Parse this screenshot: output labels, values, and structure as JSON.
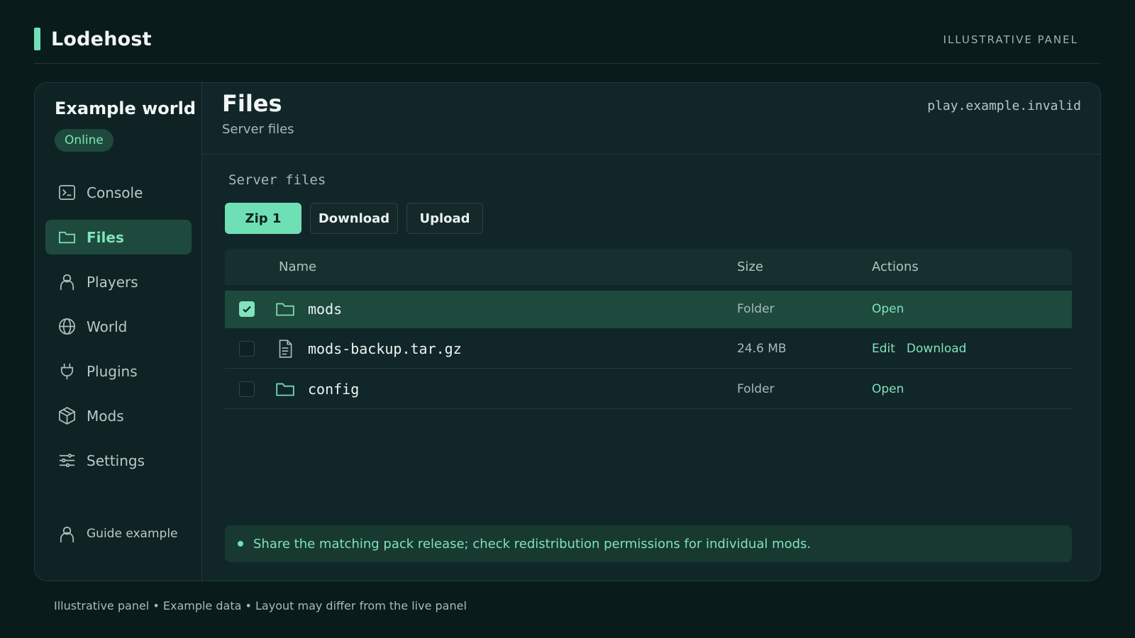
{
  "brand": {
    "name": "Lodehost",
    "tagline": "ILLUSTRATIVE PANEL"
  },
  "server": {
    "name": "Example world",
    "status": "Online",
    "host": "play.example.invalid"
  },
  "nav": {
    "items": [
      {
        "label": "Console",
        "icon": "terminal-icon",
        "active": false
      },
      {
        "label": "Files",
        "icon": "folder-icon",
        "active": true
      },
      {
        "label": "Players",
        "icon": "user-icon",
        "active": false
      },
      {
        "label": "World",
        "icon": "globe-icon",
        "active": false
      },
      {
        "label": "Plugins",
        "icon": "plug-icon",
        "active": false
      },
      {
        "label": "Mods",
        "icon": "cube-icon",
        "active": false
      },
      {
        "label": "Settings",
        "icon": "sliders-icon",
        "active": false
      }
    ],
    "footer_user": "Guide example"
  },
  "page": {
    "title": "Files",
    "subtitle": "Server files"
  },
  "files": {
    "section_label": "Server files",
    "toolbar": {
      "zip_label": "Zip 1",
      "download_label": "Download",
      "upload_label": "Upload"
    },
    "columns": {
      "name": "Name",
      "size": "Size",
      "actions": "Actions"
    },
    "rows": [
      {
        "name": "mods",
        "type": "folder",
        "size": "Folder",
        "selected": true,
        "actions": [
          "Open"
        ]
      },
      {
        "name": "mods-backup.tar.gz",
        "type": "file",
        "size": "24.6 MB",
        "selected": false,
        "actions": [
          "Edit",
          "Download"
        ]
      },
      {
        "name": "config",
        "type": "folder",
        "size": "Folder",
        "selected": false,
        "actions": [
          "Open"
        ]
      }
    ]
  },
  "notice": "Share the matching pack release; check redistribution permissions for individual mods.",
  "footer_note": "Illustrative panel • Example data • Layout may differ from the live panel",
  "colors": {
    "accent": "#6fe0b5",
    "background": "#0a1b1c",
    "panel": "#112628",
    "selected": "#1e4a3d"
  }
}
